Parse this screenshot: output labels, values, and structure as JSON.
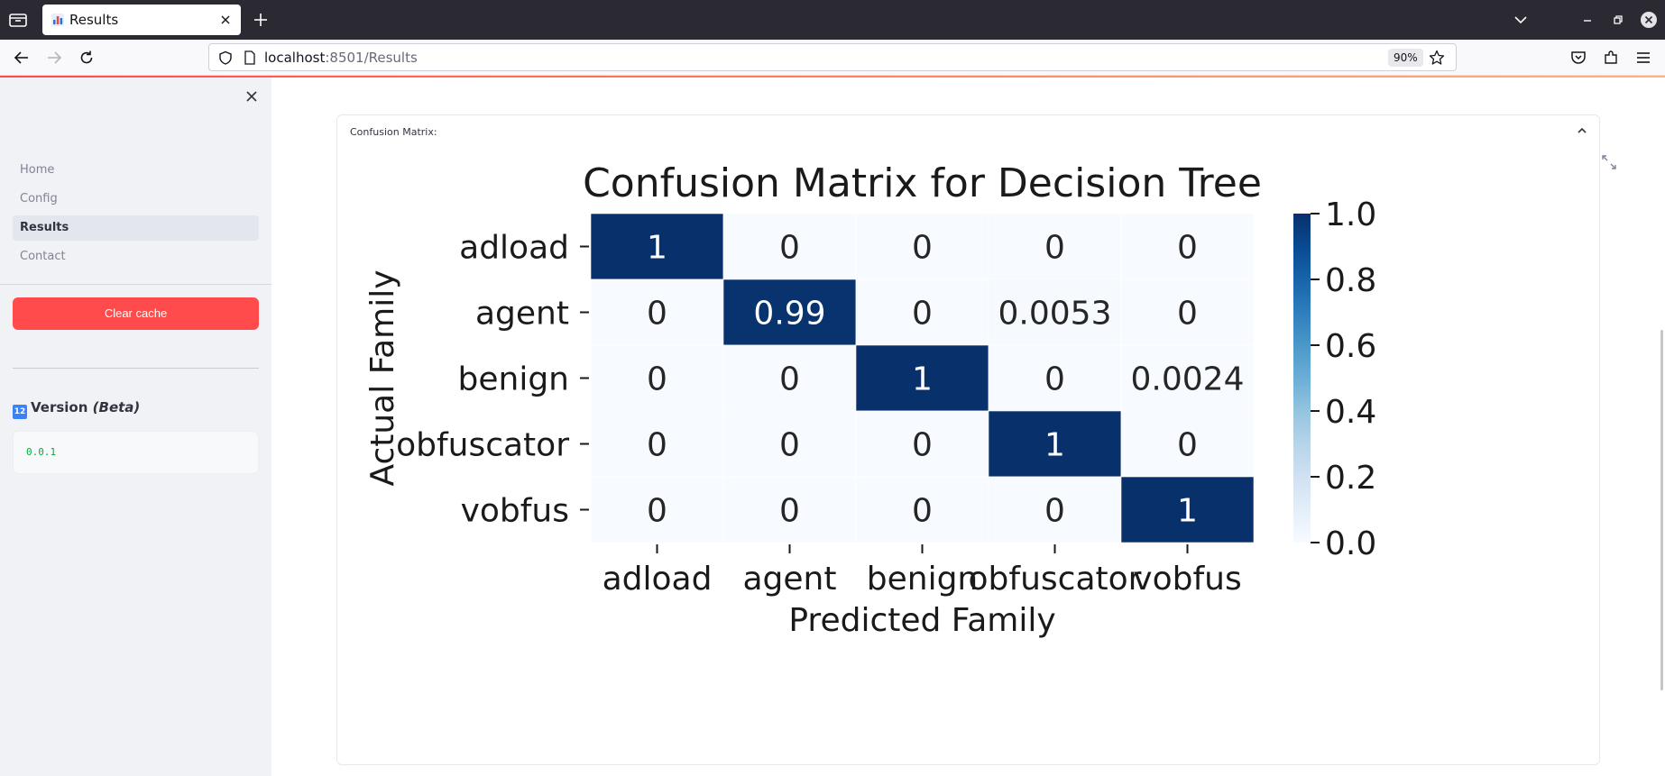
{
  "browser": {
    "tab_title": "Results",
    "url_host": "localhost",
    "url_rest": ":8501/Results",
    "zoom": "90%"
  },
  "sidebar": {
    "items": [
      {
        "label": "Home",
        "active": false
      },
      {
        "label": "Config",
        "active": false
      },
      {
        "label": "Results",
        "active": true
      },
      {
        "label": "Contact",
        "active": false
      }
    ],
    "clear_cache_label": "Clear cache",
    "version_title": "Version",
    "version_tag": "(Beta)",
    "version_value": "0.0.1"
  },
  "expander": {
    "label": "Confusion Matrix:"
  },
  "chart_data": {
    "type": "heatmap",
    "title": "Confusion Matrix for Decision Tree",
    "xlabel": "Predicted Family",
    "ylabel": "Actual Family",
    "x_categories": [
      "adload",
      "agent",
      "benign",
      "obfuscator",
      "vobfus"
    ],
    "y_categories": [
      "adload",
      "agent",
      "benign",
      "obfuscator",
      "vobfus"
    ],
    "values": [
      [
        1,
        0,
        0,
        0,
        0
      ],
      [
        0,
        0.99,
        0,
        0.0053,
        0
      ],
      [
        0,
        0,
        1,
        0,
        0.0024
      ],
      [
        0,
        0,
        0,
        1,
        0
      ],
      [
        0,
        0,
        0,
        0,
        1
      ]
    ],
    "labels": [
      [
        "1",
        "0",
        "0",
        "0",
        "0"
      ],
      [
        "0",
        "0.99",
        "0",
        "0.0053",
        "0"
      ],
      [
        "0",
        "0",
        "1",
        "0",
        "0.0024"
      ],
      [
        "0",
        "0",
        "0",
        "1",
        "0"
      ],
      [
        "0",
        "0",
        "0",
        "0",
        "1"
      ]
    ],
    "colormap": "Blues",
    "colorbar_ticks": [
      "0.0",
      "0.2",
      "0.4",
      "0.6",
      "0.8",
      "1.0"
    ],
    "colorbar_range": [
      0,
      1
    ],
    "color_low": "#f7fbff",
    "color_high": "#08306b"
  }
}
